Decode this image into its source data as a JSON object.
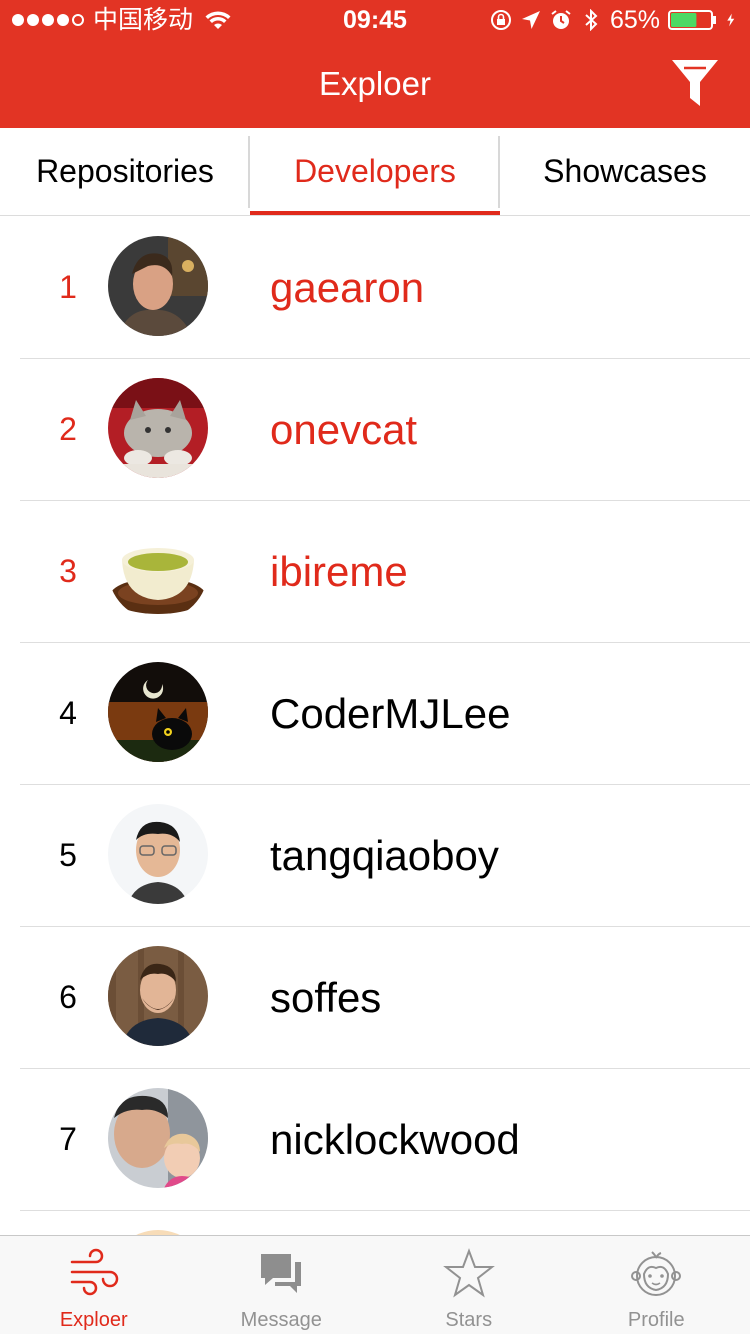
{
  "status_bar": {
    "carrier": "中国移动",
    "time": "09:45",
    "battery": "65%",
    "battery_level": 0.65
  },
  "header": {
    "title": "Exploer",
    "filter_icon": "filter-icon"
  },
  "tabs": [
    {
      "label": "Repositories",
      "active": false
    },
    {
      "label": "Developers",
      "active": true
    },
    {
      "label": "Showcases",
      "active": false
    }
  ],
  "developers": [
    {
      "rank": "1",
      "name": "gaearon"
    },
    {
      "rank": "2",
      "name": "onevcat"
    },
    {
      "rank": "3",
      "name": "ibireme"
    },
    {
      "rank": "4",
      "name": "CoderMJLee"
    },
    {
      "rank": "5",
      "name": "tangqiaoboy"
    },
    {
      "rank": "6",
      "name": "soffes"
    },
    {
      "rank": "7",
      "name": "nicklockwood"
    }
  ],
  "tabbar": [
    {
      "label": "Exploer",
      "icon": "wind-icon",
      "active": true
    },
    {
      "label": "Message",
      "icon": "chat-bubbles-icon",
      "active": false
    },
    {
      "label": "Stars",
      "icon": "star-icon",
      "active": false
    },
    {
      "label": "Profile",
      "icon": "monkey-face-icon",
      "active": false
    }
  ],
  "colors": {
    "accent": "#e23424",
    "highlight_text": "#e02a1b",
    "inactive_tab": "#929292"
  }
}
